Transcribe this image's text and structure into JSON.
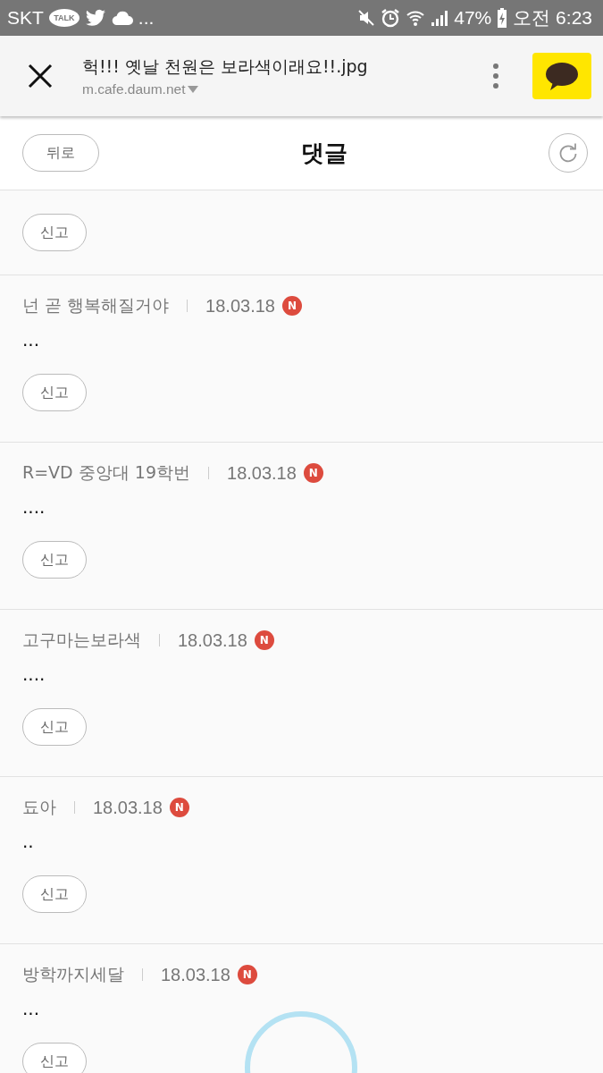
{
  "status_bar": {
    "carrier": "SKT",
    "talk_badge": "TALK",
    "more": "...",
    "battery": "47%",
    "time": "오전 6:23"
  },
  "browser_header": {
    "title": "헉!!! 옛날 천원은 보라색이래요!!.jpg",
    "url": "m.cafe.daum.net"
  },
  "page_header": {
    "back": "뒤로",
    "title": "댓글"
  },
  "top_report": "신고",
  "comments": [
    {
      "author": "넌 곧 행복해질거야",
      "date": "18.03.18",
      "new_badge": "N",
      "body": "...",
      "report": "신고"
    },
    {
      "author": "R=VD 중앙대 19학번",
      "date": "18.03.18",
      "new_badge": "N",
      "body": "....",
      "report": "신고"
    },
    {
      "author": "고구마는보라색",
      "date": "18.03.18",
      "new_badge": "N",
      "body": "....",
      "report": "신고"
    },
    {
      "author": "됴아",
      "date": "18.03.18",
      "new_badge": "N",
      "body": "..",
      "report": "신고"
    },
    {
      "author": "방학까지세달",
      "date": "18.03.18",
      "new_badge": "N",
      "body": "...",
      "report": "신고"
    }
  ]
}
